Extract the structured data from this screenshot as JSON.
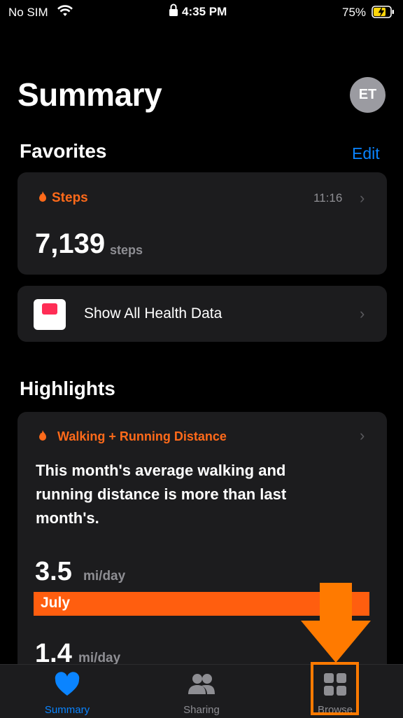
{
  "status_bar": {
    "carrier": "No SIM",
    "time": "4:35 PM",
    "battery_percent": "75%"
  },
  "header": {
    "title": "Summary",
    "avatar_initials": "ET"
  },
  "favorites": {
    "title": "Favorites",
    "edit_label": "Edit",
    "steps": {
      "label": "Steps",
      "time": "11:16",
      "value": "7,139",
      "unit": "steps"
    },
    "show_all_label": "Show All Health Data"
  },
  "highlights": {
    "title": "Highlights",
    "card": {
      "label": "Walking + Running Distance",
      "text": "This month's average walking and running distance is more than last month's.",
      "value1": "3.5",
      "unit1": "mi/day",
      "bar_label": "July",
      "value2": "1.4",
      "unit2": "mi/day"
    }
  },
  "tab_bar": {
    "tabs": [
      {
        "label": "Summary",
        "icon": "heart-icon",
        "active": true
      },
      {
        "label": "Sharing",
        "icon": "people-icon",
        "active": false
      },
      {
        "label": "Browse",
        "icon": "grid-icon",
        "active": false
      }
    ]
  },
  "colors": {
    "accent_blue": "#0a84ff",
    "activity_orange": "#ff6a1a",
    "annotation_orange": "#ff7a00"
  }
}
